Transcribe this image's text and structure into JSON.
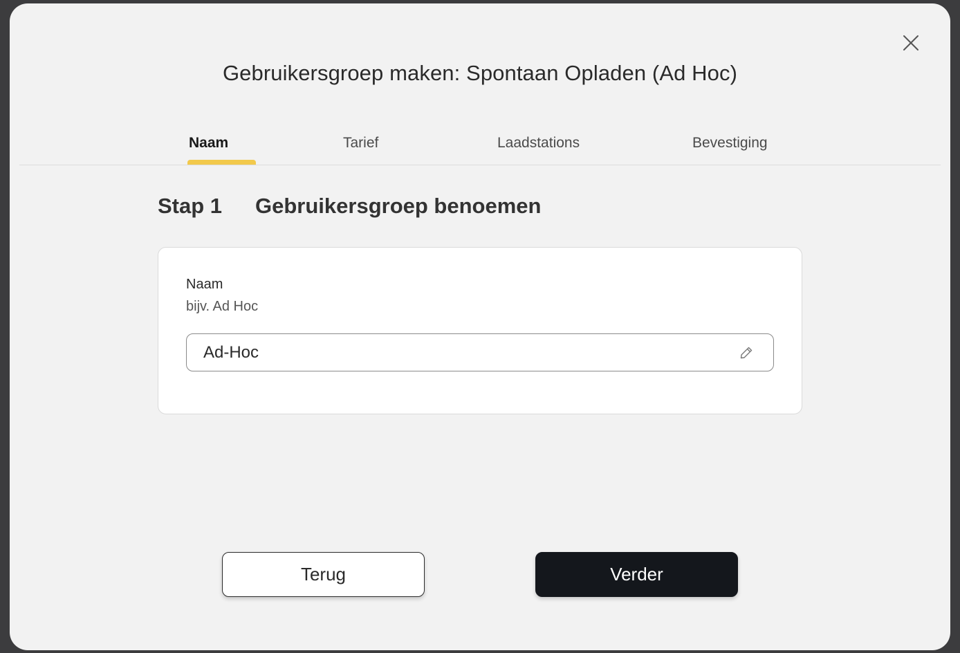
{
  "modal": {
    "title": "Gebruikersgroep maken: Spontaan Opladen (Ad Hoc)",
    "close_icon": "close-icon"
  },
  "tabs": [
    {
      "label": "Naam",
      "active": true
    },
    {
      "label": "Tarief",
      "active": false
    },
    {
      "label": "Laadstations",
      "active": false
    },
    {
      "label": "Bevestiging",
      "active": false
    }
  ],
  "step": {
    "label": "Stap 1",
    "title": "Gebruikersgroep benoemen"
  },
  "form": {
    "name_label": "Naam",
    "name_hint": "bijv. Ad Hoc",
    "name_value": "Ad-Hoc",
    "edit_icon": "pencil-icon"
  },
  "footer": {
    "back_label": "Terug",
    "next_label": "Verder"
  },
  "colors": {
    "accent": "#f2c94c",
    "primary_button": "#14171c",
    "modal_bg": "#f2f2f2"
  }
}
